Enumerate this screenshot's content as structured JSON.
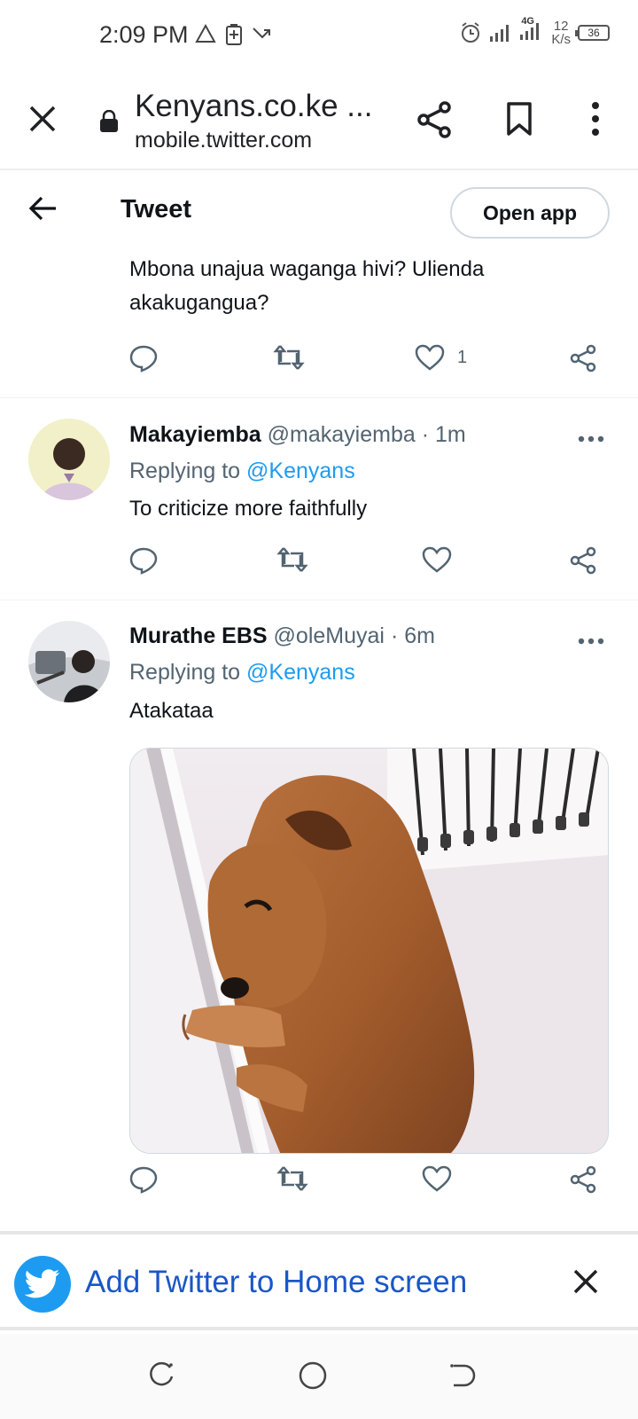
{
  "status_bar": {
    "time": "2:09 PM",
    "network": "4G",
    "speed_value": "12",
    "speed_unit": "K/s",
    "battery": "36"
  },
  "browser": {
    "page_title": "Kenyans.co.ke ...",
    "url": "mobile.twitter.com"
  },
  "twitter_header": {
    "title": "Tweet",
    "open_app_label": "Open app"
  },
  "tweets": [
    {
      "text_line1": "Mbona unajua waganga hivi? Ulienda",
      "text_line2": "akakugangua?",
      "like_count": "1"
    },
    {
      "name": "Makayiemba",
      "handle": "@makayiemba",
      "time": "1m",
      "replying_prefix": "Replying to",
      "replying_to": "@Kenyans",
      "text": "To criticize more faithfully"
    },
    {
      "name": "Murathe EBS",
      "handle": "@oleMuyai",
      "time": "6m",
      "replying_prefix": "Replying to",
      "replying_to": "@Kenyans",
      "text": "Atakataa"
    }
  ],
  "banner": {
    "text": "Add Twitter to Home screen"
  },
  "colors": {
    "twitter_blue": "#1d9bf0",
    "secondary_text": "#536471",
    "banner_link": "#1a56c8"
  }
}
